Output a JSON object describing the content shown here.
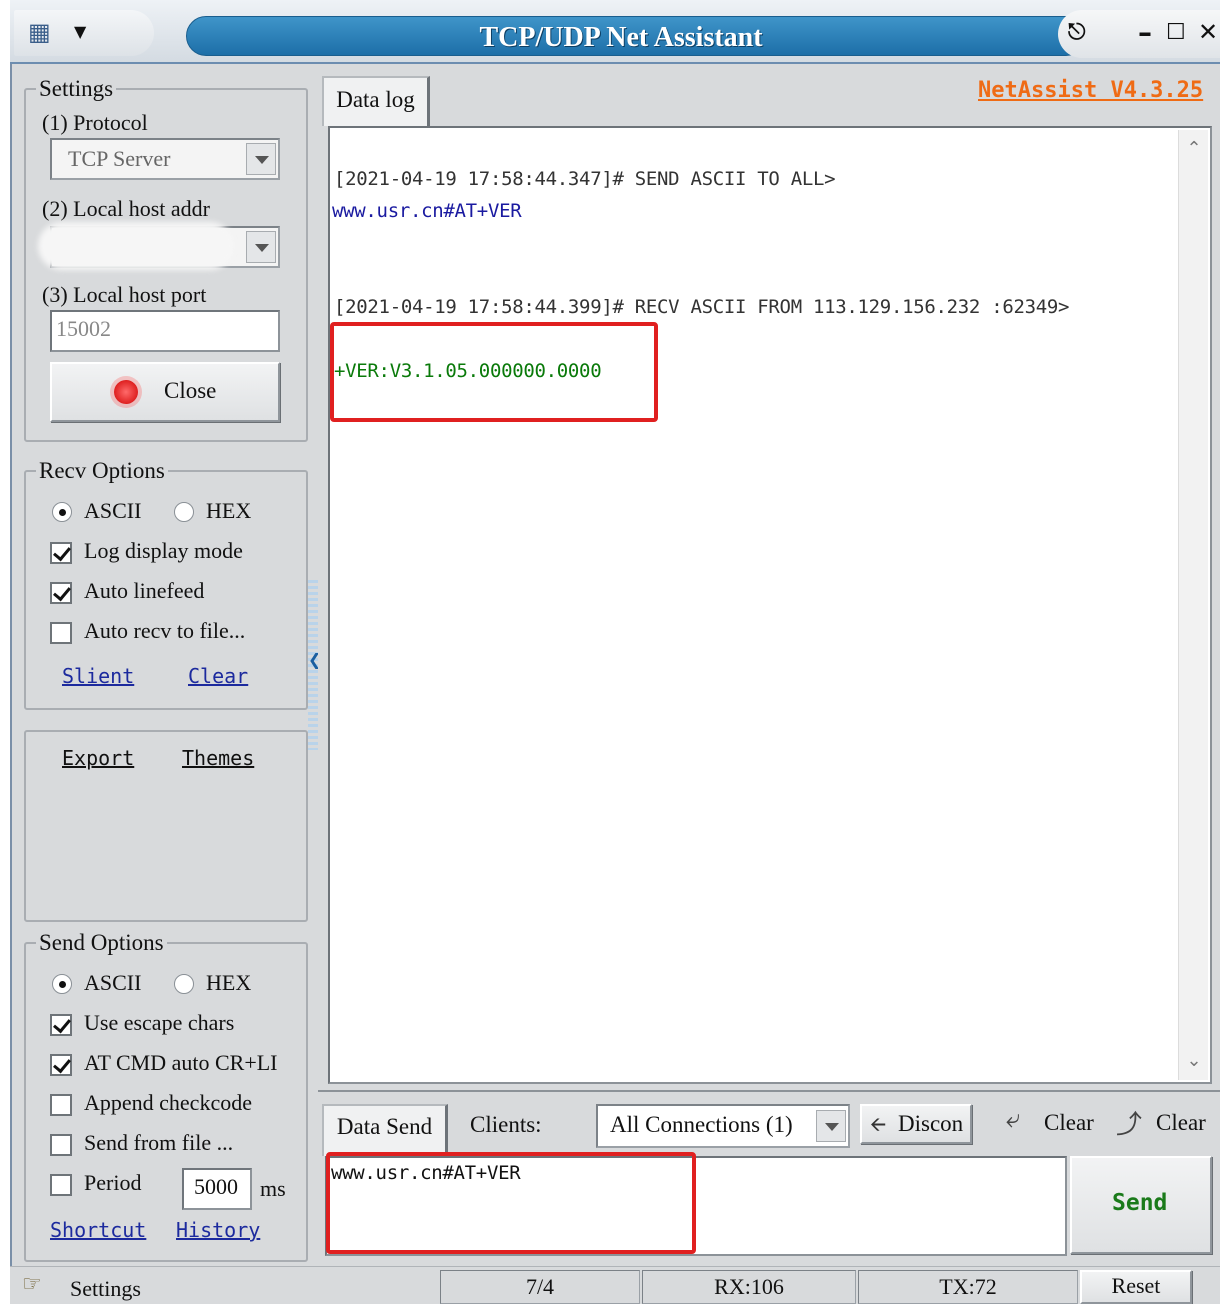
{
  "window": {
    "title": "TCP/UDP Net Assistant",
    "version": "NetAssist V4.3.25"
  },
  "settings": {
    "group_title": "Settings",
    "protocol_label": "(1) Protocol",
    "protocol_value": "TCP Server",
    "host_addr_label": "(2) Local host addr",
    "host_addr_value": "",
    "host_port_label": "(3) Local host port",
    "host_port_value": "15002",
    "close_button": "Close"
  },
  "recv_options": {
    "group_title": "Recv Options",
    "ascii": "ASCII",
    "hex": "HEX",
    "selected": "ASCII",
    "log_display_mode": "Log display mode",
    "log_display_mode_checked": true,
    "auto_linefeed": "Auto linefeed",
    "auto_linefeed_checked": true,
    "auto_recv_to_file": "Auto recv to file...",
    "auto_recv_to_file_checked": false,
    "slient_link": "Slient",
    "clear_link": "Clear"
  },
  "extra": {
    "export_link": "Export",
    "themes_link": "Themes"
  },
  "send_options": {
    "group_title": "Send Options",
    "ascii": "ASCII",
    "hex": "HEX",
    "selected": "ASCII",
    "use_escape_chars": "Use escape chars",
    "use_escape_chars_checked": true,
    "at_cmd_auto": "AT CMD auto CR+LI",
    "at_cmd_auto_checked": true,
    "append_checkcode": "Append checkcode",
    "append_checkcode_checked": false,
    "send_from_file": "Send from file ...",
    "send_from_file_checked": false,
    "period": "Period",
    "period_checked": false,
    "period_value": "5000",
    "period_unit": "ms",
    "shortcut_link": "Shortcut",
    "history_link": "History"
  },
  "data_log": {
    "tab_label": "Data log",
    "lines": [
      {
        "text": "[2021-04-19 17:58:44.347]# SEND ASCII TO ALL>",
        "color": "#333333"
      },
      {
        "text": "www.usr.cn#AT+VER",
        "color": "#1a1aa0"
      },
      {
        "text": "[2021-04-19 17:58:44.399]# RECV ASCII FROM 113.129.156.232 :62349>",
        "color": "#333333"
      },
      {
        "text": "+VER:V3.1.05.000000.0000",
        "color": "#0a7a0a"
      }
    ]
  },
  "data_send": {
    "tab_label": "Data Send",
    "clients_label": "Clients:",
    "clients_value": "All Connections (1)",
    "discon_button": "Discon",
    "clear_button_1": "Clear",
    "clear_button_2": "Clear",
    "send_text": "www.usr.cn#AT+VER",
    "send_button": "Send"
  },
  "status": {
    "settings_label": "Settings",
    "count": "7/4",
    "rx": "RX:106",
    "tx": "TX:72",
    "reset_button": "Reset"
  },
  "colors": {
    "title_bar": "#1d6fa8",
    "highlight_box": "#e02020",
    "version_text": "#ef6b15",
    "send_text": "#1a7a1a"
  }
}
